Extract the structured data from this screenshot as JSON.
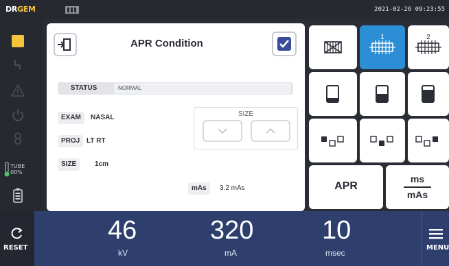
{
  "header": {
    "logo_a": "DR",
    "logo_b": "GEM",
    "datetime": "2021-02-26 09:23:55",
    "brand_color": "#f5c43a"
  },
  "sidebar": {
    "icons": [
      "folder-icon",
      "lightning-icon",
      "warning-icon",
      "power-icon",
      "heater-icon",
      "thermometer-icon",
      "battery-icon"
    ],
    "tube_label": "TUBE",
    "tube_value": "00%"
  },
  "panel": {
    "title": "APR Condition",
    "checked": true,
    "status": {
      "key": "STATUS",
      "value": "NORMAL"
    },
    "exam": {
      "key": "EXAM",
      "value": "NASAL"
    },
    "proj": {
      "key": "PROJ",
      "value": "LT RT"
    },
    "size": {
      "key": "SIZE",
      "value": "1cm"
    },
    "size_control_label": "SIZE",
    "mas": {
      "key": "mAs",
      "value": "3.2 mAs"
    }
  },
  "grid": {
    "row1": [
      "grid-off-icon",
      "grid-1-icon",
      "grid-2-icon"
    ],
    "grid1_number": "1",
    "grid2_number": "2",
    "row1_active_index": 1,
    "row2": [
      "density-low-icon",
      "density-mid-icon",
      "density-high-icon"
    ],
    "row3": [
      "field-left-icon",
      "field-center-icon",
      "field-right-icon"
    ],
    "apr_label": "APR",
    "ms_label_top": "ms",
    "ms_label_bottom": "mAs",
    "active_color": "#2c8fd6"
  },
  "bottom": {
    "reset_label": "RESET",
    "kv_value": "46",
    "kv_unit": "kV",
    "ma_value": "320",
    "ma_unit": "mA",
    "msec_value": "10",
    "msec_unit": "msec",
    "menu_label": "MENU",
    "bar_color": "#2e3f6e"
  }
}
